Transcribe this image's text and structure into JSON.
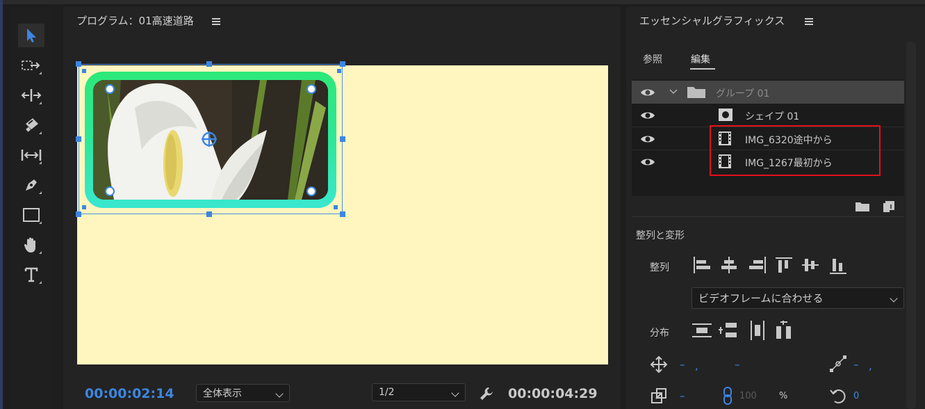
{
  "tools": [
    {
      "name": "selection-tool-icon",
      "active": true
    },
    {
      "name": "track-select-tool-icon",
      "active": false
    },
    {
      "name": "ripple-edit-tool-icon",
      "active": false
    },
    {
      "name": "razor-tool-icon",
      "active": false
    },
    {
      "name": "slip-tool-icon",
      "active": false
    },
    {
      "name": "pen-tool-icon",
      "active": false
    },
    {
      "name": "rectangle-tool-icon",
      "active": false
    },
    {
      "name": "hand-tool-icon",
      "active": false
    },
    {
      "name": "type-tool-icon",
      "active": false
    }
  ],
  "program": {
    "title": "プログラム：01高速道路",
    "current_time": "00:00:02:14",
    "zoom_select": "全体表示",
    "resolution_select": "1/2",
    "duration": "00:00:04:29"
  },
  "essential_graphics": {
    "title": "エッセンシャルグラフィックス",
    "tabs": [
      {
        "label": "参照",
        "active": false
      },
      {
        "label": "編集",
        "active": true
      }
    ],
    "layers": [
      {
        "label": "グループ 01",
        "type": "group",
        "highlighted": true
      },
      {
        "label": "シェイプ 01",
        "type": "shape",
        "highlighted": false
      },
      {
        "label": "IMG_6320途中から",
        "type": "clip",
        "highlighted": false
      },
      {
        "label": "IMG_1267最初から",
        "type": "clip",
        "highlighted": false
      }
    ],
    "align_section": {
      "title": "整列と変形",
      "align_label": "整列",
      "align_to": "ビデオフレームに合わせる",
      "distribute_label": "分布"
    },
    "transform": {
      "position_x": "–",
      "position_sep": ",",
      "position_y": "–",
      "anchor_x": "–",
      "anchor_sep": ",",
      "scale": "–",
      "scale_value": "100",
      "percent": "%",
      "rotation": "0"
    }
  },
  "colors": {
    "accent": "#3d86e0",
    "canvas": "#fff6bf",
    "shape_stroke_top": "#2de879",
    "shape_stroke_bottom": "#39e7d0",
    "highlight": "#e3101a"
  }
}
